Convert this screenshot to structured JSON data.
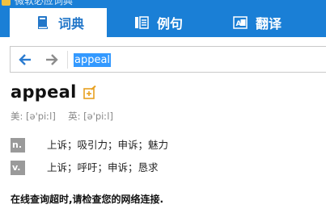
{
  "window": {
    "title": "微软必应词典"
  },
  "tabs": [
    {
      "label": "词典",
      "icon": "book-icon",
      "active": true
    },
    {
      "label": "例句",
      "icon": "sentence-list-icon",
      "active": false
    },
    {
      "label": "翻译",
      "icon": "translate-icon",
      "active": false
    }
  ],
  "search": {
    "value": "appeal"
  },
  "entry": {
    "headword": "appeal",
    "phonetic_us_label": "美:",
    "phonetic_us": "[ə'piːl]",
    "phonetic_uk_label": "英:",
    "phonetic_uk": "[ə'piːl]",
    "definitions": [
      {
        "pos": "n.",
        "text": "上诉；吸引力；申诉；魅力"
      },
      {
        "pos": "v.",
        "text": "上诉；呼吁；申诉；恳求"
      }
    ]
  },
  "notice": "在线查询超时,请检查您的网络连接.",
  "colors": {
    "brand_blue": "#1a7fd6",
    "active_tab_text": "#2377c9",
    "selection": "#3399ff",
    "pos_badge": "#9a9a9a",
    "wordbook_icon": "#e8a020"
  }
}
